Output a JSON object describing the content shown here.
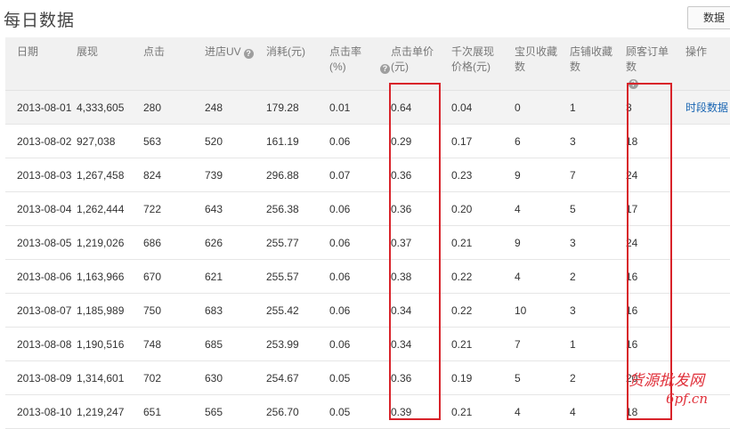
{
  "page": {
    "title": "每日数据",
    "data_button": "数据"
  },
  "table": {
    "columns": [
      {
        "label": "日期",
        "help": false
      },
      {
        "label": "展现",
        "help": false
      },
      {
        "label": "点击",
        "help": false
      },
      {
        "label": "进店UV",
        "help": true
      },
      {
        "label": "消耗(元)",
        "help": false
      },
      {
        "label": "点击率(%)",
        "help": true
      },
      {
        "label": "点击单价(元)",
        "help": false
      },
      {
        "label": "千次展现价格(元)",
        "help": false
      },
      {
        "label": "宝贝收藏数",
        "help": false
      },
      {
        "label": "店铺收藏数",
        "help": false
      },
      {
        "label": "顾客订单数",
        "help": true
      },
      {
        "label": "操作",
        "help": false
      }
    ],
    "action_label": "时段数据",
    "rows": [
      [
        "2013-08-01",
        "4,333,605",
        "280",
        "248",
        "179.28",
        "0.01",
        "0.64",
        "0.04",
        "0",
        "1",
        "3"
      ],
      [
        "2013-08-02",
        "927,038",
        "563",
        "520",
        "161.19",
        "0.06",
        "0.29",
        "0.17",
        "6",
        "3",
        "18"
      ],
      [
        "2013-08-03",
        "1,267,458",
        "824",
        "739",
        "296.88",
        "0.07",
        "0.36",
        "0.23",
        "9",
        "7",
        "24"
      ],
      [
        "2013-08-04",
        "1,262,444",
        "722",
        "643",
        "256.38",
        "0.06",
        "0.36",
        "0.20",
        "4",
        "5",
        "17"
      ],
      [
        "2013-08-05",
        "1,219,026",
        "686",
        "626",
        "255.77",
        "0.06",
        "0.37",
        "0.21",
        "9",
        "3",
        "24"
      ],
      [
        "2013-08-06",
        "1,163,966",
        "670",
        "621",
        "255.57",
        "0.06",
        "0.38",
        "0.22",
        "4",
        "2",
        "16"
      ],
      [
        "2013-08-07",
        "1,185,989",
        "750",
        "683",
        "255.42",
        "0.06",
        "0.34",
        "0.22",
        "10",
        "3",
        "16"
      ],
      [
        "2013-08-08",
        "1,190,516",
        "748",
        "685",
        "253.99",
        "0.06",
        "0.34",
        "0.21",
        "7",
        "1",
        "16"
      ],
      [
        "2013-08-09",
        "1,314,601",
        "702",
        "630",
        "254.67",
        "0.05",
        "0.36",
        "0.19",
        "5",
        "2",
        "20"
      ],
      [
        "2013-08-10",
        "1,219,247",
        "651",
        "565",
        "256.70",
        "0.05",
        "0.39",
        "0.21",
        "4",
        "4",
        "18"
      ]
    ]
  },
  "watermark": {
    "line1": "货源批发网",
    "line2": "6pf.cn"
  },
  "colors": {
    "highlight": "#d8232a",
    "link": "#1a66b3",
    "header_bg": "#f1f1f1"
  }
}
